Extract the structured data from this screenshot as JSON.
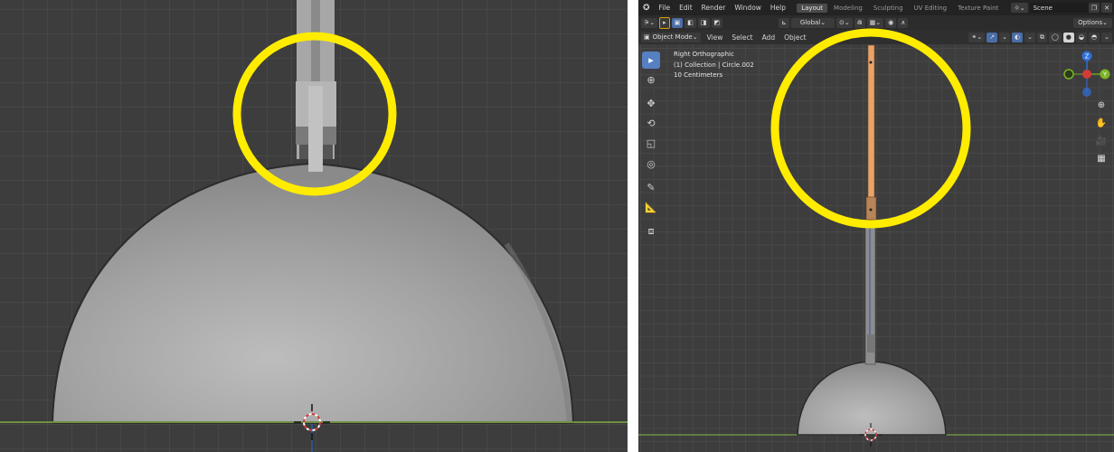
{
  "left_view": {
    "highlight_color": "#ffec00"
  },
  "right_view": {
    "menu": {
      "file": "File",
      "edit": "Edit",
      "render": "Render",
      "window": "Window",
      "help": "Help"
    },
    "workspaces": [
      "Layout",
      "Modeling",
      "Sculpting",
      "UV Editing",
      "Texture Paint"
    ],
    "active_workspace": "Layout",
    "scene_name": "Scene",
    "transform_orientation": "Global",
    "options_label": "Options",
    "header": {
      "mode": "Object Mode",
      "view": "View",
      "select": "Select",
      "add": "Add",
      "object": "Object"
    },
    "viewport_info": {
      "view_name": "Right Orthographic",
      "collection": "(1) Collection | Circle.002",
      "scale": "10 Centimeters"
    },
    "gizmo_axes": {
      "z": "Z",
      "y": "Y"
    },
    "colors": {
      "selected_object": "#e8a36a",
      "highlight": "#ffec00",
      "active_tool": "#5680c2"
    }
  }
}
